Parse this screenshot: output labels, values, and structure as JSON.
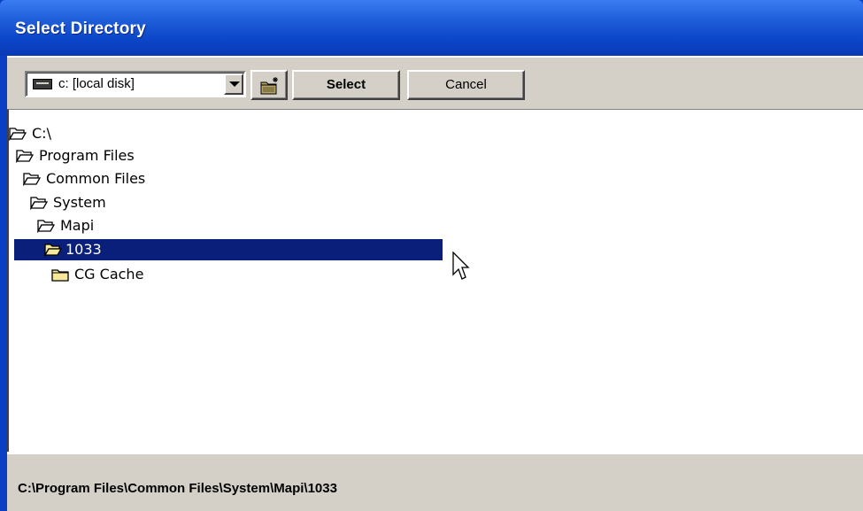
{
  "window": {
    "title": "Select Directory"
  },
  "toolbar": {
    "drive_combo_value": "c: [local disk]",
    "select_label": "Select",
    "cancel_label": "Cancel"
  },
  "tree": {
    "nodes": [
      {
        "label": "C:\\"
      },
      {
        "label": "Program Files"
      },
      {
        "label": "Common Files"
      },
      {
        "label": "System"
      },
      {
        "label": "Mapi"
      },
      {
        "label": "1033"
      },
      {
        "label": "CG Cache"
      }
    ]
  },
  "status": {
    "path": "C:\\Program Files\\Common Files\\System\\Mapi\\1033"
  },
  "colors": {
    "titlebar": "#0c46c9",
    "selection": "#0a1f7a",
    "face": "#d4d0c8",
    "folder_fill": "#f6e79a"
  }
}
